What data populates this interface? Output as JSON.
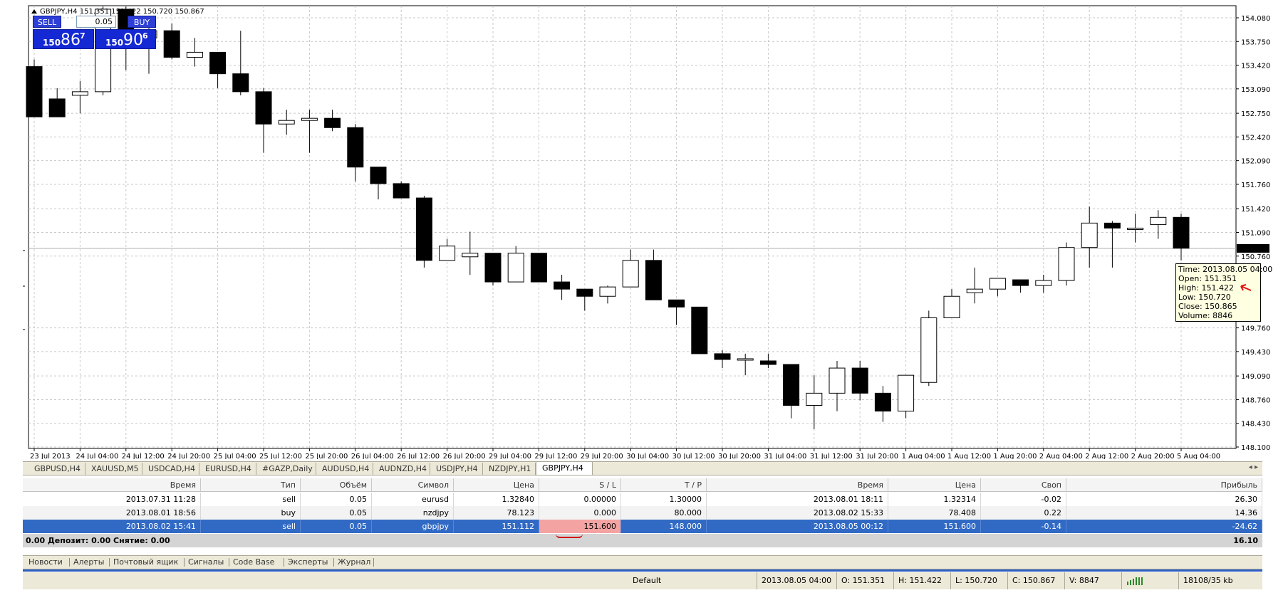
{
  "chart": {
    "header": "GBPJPY,H4  151.351 151.422 150.720 150.867",
    "current_price_label": "150.867",
    "price_ticks": [
      "154.080",
      "153.750",
      "153.420",
      "153.090",
      "152.750",
      "152.420",
      "152.090",
      "151.760",
      "151.420",
      "151.090",
      "150.760",
      "149.760",
      "149.430",
      "149.090",
      "148.760",
      "148.430",
      "148.100"
    ],
    "time_ticks": [
      "23 Jul 2013",
      "24 Jul 04:00",
      "24 Jul 12:00",
      "24 Jul 20:00",
      "25 Jul 04:00",
      "25 Jul 12:00",
      "25 Jul 20:00",
      "26 Jul 04:00",
      "26 Jul 12:00",
      "26 Jul 20:00",
      "29 Jul 04:00",
      "29 Jul 12:00",
      "29 Jul 20:00",
      "30 Jul 04:00",
      "30 Jul 12:00",
      "30 Jul 20:00",
      "31 Jul 04:00",
      "31 Jul 12:00",
      "31 Jul 20:00",
      "1 Aug 04:00",
      "1 Aug 12:00",
      "1 Aug 20:00",
      "2 Aug 04:00",
      "2 Aug 12:00",
      "2 Aug 20:00",
      "5 Aug 04:00"
    ],
    "y_min": 148.1,
    "y_max": 154.08,
    "current_price": 150.867
  },
  "chart_data": {
    "type": "candlestick",
    "title": "GBPJPY,H4",
    "candles": [
      {
        "o": 153.4,
        "h": 153.5,
        "l": 152.7,
        "c": 152.7
      },
      {
        "o": 152.95,
        "h": 153.1,
        "l": 152.7,
        "c": 152.7
      },
      {
        "o": 153.0,
        "h": 153.2,
        "l": 152.75,
        "c": 153.05
      },
      {
        "o": 153.05,
        "h": 154.3,
        "l": 153.0,
        "c": 154.2
      },
      {
        "o": 154.2,
        "h": 154.3,
        "l": 153.35,
        "c": 153.8
      },
      {
        "o": 153.8,
        "h": 153.95,
        "l": 153.3,
        "c": 153.9
      },
      {
        "o": 153.9,
        "h": 154.0,
        "l": 153.5,
        "c": 153.53
      },
      {
        "o": 153.53,
        "h": 153.8,
        "l": 153.4,
        "c": 153.6
      },
      {
        "o": 153.6,
        "h": 153.6,
        "l": 153.1,
        "c": 153.3
      },
      {
        "o": 153.3,
        "h": 153.9,
        "l": 153.0,
        "c": 153.05
      },
      {
        "o": 153.05,
        "h": 153.1,
        "l": 152.2,
        "c": 152.6
      },
      {
        "o": 152.6,
        "h": 152.8,
        "l": 152.45,
        "c": 152.65
      },
      {
        "o": 152.65,
        "h": 152.8,
        "l": 152.2,
        "c": 152.68
      },
      {
        "o": 152.68,
        "h": 152.8,
        "l": 152.5,
        "c": 152.55
      },
      {
        "o": 152.55,
        "h": 152.6,
        "l": 151.8,
        "c": 152.0
      },
      {
        "o": 152.0,
        "h": 152.0,
        "l": 151.55,
        "c": 151.77
      },
      {
        "o": 151.77,
        "h": 151.8,
        "l": 151.6,
        "c": 151.57
      },
      {
        "o": 151.57,
        "h": 151.6,
        "l": 150.6,
        "c": 150.7
      },
      {
        "o": 150.7,
        "h": 151.0,
        "l": 150.7,
        "c": 150.9
      },
      {
        "o": 150.75,
        "h": 151.1,
        "l": 150.5,
        "c": 150.8
      },
      {
        "o": 150.8,
        "h": 150.8,
        "l": 150.35,
        "c": 150.4
      },
      {
        "o": 150.4,
        "h": 150.9,
        "l": 150.4,
        "c": 150.8
      },
      {
        "o": 150.8,
        "h": 150.8,
        "l": 150.4,
        "c": 150.4
      },
      {
        "o": 150.4,
        "h": 150.5,
        "l": 150.15,
        "c": 150.3
      },
      {
        "o": 150.3,
        "h": 150.3,
        "l": 150.0,
        "c": 150.2
      },
      {
        "o": 150.2,
        "h": 150.35,
        "l": 150.1,
        "c": 150.33
      },
      {
        "o": 150.33,
        "h": 150.85,
        "l": 150.33,
        "c": 150.7
      },
      {
        "o": 150.7,
        "h": 150.85,
        "l": 150.15,
        "c": 150.15
      },
      {
        "o": 150.15,
        "h": 150.15,
        "l": 149.8,
        "c": 150.05
      },
      {
        "o": 150.05,
        "h": 150.05,
        "l": 149.4,
        "c": 149.4
      },
      {
        "o": 149.4,
        "h": 149.45,
        "l": 149.2,
        "c": 149.32
      },
      {
        "o": 149.33,
        "h": 149.4,
        "l": 149.1,
        "c": 149.33
      },
      {
        "o": 149.3,
        "h": 149.4,
        "l": 149.2,
        "c": 149.25
      },
      {
        "o": 149.25,
        "h": 149.25,
        "l": 148.5,
        "c": 148.68
      },
      {
        "o": 148.68,
        "h": 149.1,
        "l": 148.35,
        "c": 148.85
      },
      {
        "o": 148.85,
        "h": 149.3,
        "l": 148.6,
        "c": 149.2
      },
      {
        "o": 149.2,
        "h": 149.3,
        "l": 148.75,
        "c": 148.85
      },
      {
        "o": 148.85,
        "h": 148.95,
        "l": 148.45,
        "c": 148.6
      },
      {
        "o": 148.6,
        "h": 149.1,
        "l": 148.5,
        "c": 149.1
      },
      {
        "o": 149.0,
        "h": 150.0,
        "l": 148.95,
        "c": 149.9
      },
      {
        "o": 149.9,
        "h": 150.3,
        "l": 149.9,
        "c": 150.2
      },
      {
        "o": 150.25,
        "h": 150.6,
        "l": 150.1,
        "c": 150.3
      },
      {
        "o": 150.3,
        "h": 150.43,
        "l": 150.2,
        "c": 150.45
      },
      {
        "o": 150.43,
        "h": 150.43,
        "l": 150.25,
        "c": 150.35
      },
      {
        "o": 150.35,
        "h": 150.5,
        "l": 150.25,
        "c": 150.42
      },
      {
        "o": 150.42,
        "h": 150.95,
        "l": 150.35,
        "c": 150.88
      },
      {
        "o": 150.88,
        "h": 151.45,
        "l": 150.6,
        "c": 151.22
      },
      {
        "o": 151.22,
        "h": 151.25,
        "l": 150.6,
        "c": 151.15
      },
      {
        "o": 151.15,
        "h": 151.35,
        "l": 150.95,
        "c": 151.15
      },
      {
        "o": 151.2,
        "h": 151.4,
        "l": 151.0,
        "c": 151.3
      },
      {
        "o": 151.3,
        "h": 151.35,
        "l": 150.7,
        "c": 150.87
      }
    ]
  },
  "one_click": {
    "sell_label": "SELL",
    "buy_label": "BUY",
    "lot": "0.05",
    "sell_small": "150",
    "sell_big": "86",
    "sell_sup": "7",
    "buy_small": "150",
    "buy_big": "90",
    "buy_sup": "6"
  },
  "tooltip": {
    "time": "Time: 2013.08.05 04:00",
    "open": "Open: 151.351",
    "high": "High: 151.422",
    "low": "Low:  150.720",
    "close": "Close: 150.865",
    "volume": "Volume: 8846"
  },
  "symbol_tabs": [
    "GBPUSD,H4",
    "XAUUSD,M5",
    "USDCAD,H4",
    "EURUSD,H4",
    "#GAZP,Daily",
    "AUDUSD,H4",
    "AUDNZD,H4",
    "USDJPY,H4",
    "NZDJPY,H1",
    "GBPJPY,H4"
  ],
  "tab_scroll": "◂ ▸",
  "terminal": {
    "headers": [
      "Время",
      "Тип",
      "Объём",
      "Символ",
      "Цена",
      "S / L",
      "T / P",
      "Время",
      "Цена",
      "Своп",
      "Прибыль"
    ],
    "rows": [
      [
        "2013.07.31 11:28",
        "sell",
        "0.05",
        "eurusd",
        "1.32840",
        "0.00000",
        "1.30000",
        "2013.08.01 18:11",
        "1.32314",
        "-0.02",
        "26.30"
      ],
      [
        "2013.08.01 18:56",
        "buy",
        "0.05",
        "nzdjpy",
        "78.123",
        "0.000",
        "80.000",
        "2013.08.02 15:33",
        "78.408",
        "0.22",
        "14.36"
      ],
      [
        "2013.08.02 15:41",
        "sell",
        "0.05",
        "gbpjpy",
        "151.112",
        "151.600",
        "148.000",
        "2013.08.05 00:12",
        "151.600",
        "-0.14",
        "-24.62"
      ]
    ],
    "total_label": "0.00  Депозит: 0.00  Снятие: 0.00",
    "total_value": "16.10"
  },
  "bottom_tabs": [
    "Новости",
    "Алерты",
    "Почтовый ящик",
    "Сигналы",
    "Code Base",
    "Эксперты",
    "Журнал"
  ],
  "status": {
    "profile": "Default",
    "time": "2013.08.05 04:00",
    "open": "O: 151.351",
    "high": "H: 151.422",
    "low": "L: 150.720",
    "close": "C: 150.867",
    "volume": "V: 8847",
    "traffic": "18108/35 kb"
  }
}
